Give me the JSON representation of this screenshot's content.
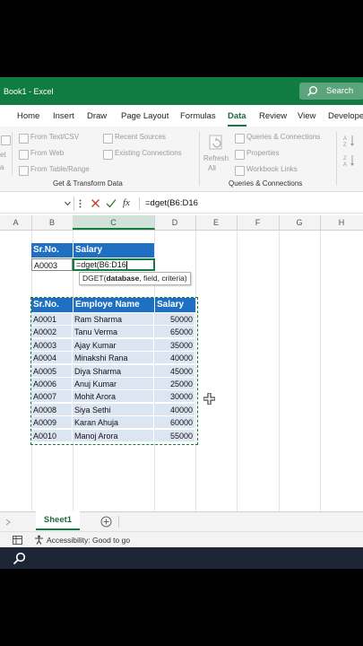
{
  "window": {
    "title": "Book1  -  Excel",
    "search_label": "Search"
  },
  "tabs": [
    "Home",
    "Insert",
    "Draw",
    "Page Layout",
    "Formulas",
    "Data",
    "Review",
    "View",
    "Develope"
  ],
  "active_tab": "Data",
  "ribbon": {
    "left_partial": [
      "et",
      "a"
    ],
    "get_transform": {
      "items": [
        "From Text/CSV",
        "From Web",
        "From Table/Range"
      ],
      "recent": [
        "Recent Sources",
        "Existing Connections"
      ],
      "group_label": "Get & Transform Data"
    },
    "refresh": {
      "line1": "Refresh",
      "line2": "All"
    },
    "queries": {
      "items": [
        "Queries & Connections",
        "Properties",
        "Workbook Links"
      ],
      "group_label": "Queries & Connections"
    },
    "sort_icons": [
      "A Z sort",
      "Z A sort"
    ]
  },
  "formula_bar": {
    "fx": "fx",
    "formula": "=dget(B6:D16"
  },
  "columns": [
    "A",
    "B",
    "C",
    "D",
    "E",
    "F",
    "G",
    "H"
  ],
  "criteria_table": {
    "headers": [
      "Sr.No.",
      "Salary"
    ],
    "row": [
      "A0003",
      "=dget(B6:D16"
    ]
  },
  "tooltip": {
    "fn": "DGET(",
    "arg1": "database",
    "rest": ", field, criteria)"
  },
  "data_table": {
    "headers": [
      "Sr.No.",
      "Employe Name",
      "Salary"
    ],
    "rows": [
      [
        "A0001",
        "Ram Sharma",
        "50000"
      ],
      [
        "A0002",
        "Tanu Verma",
        "65000"
      ],
      [
        "A0003",
        "Ajay Kumar",
        "35000"
      ],
      [
        "A0004",
        "Minakshi Rana",
        "40000"
      ],
      [
        "A0005",
        "Diya Sharma",
        "45000"
      ],
      [
        "A0006",
        "Anuj Kumar",
        "25000"
      ],
      [
        "A0007",
        "Mohit Arora",
        "30000"
      ],
      [
        "A0008",
        "Siya Sethi",
        "40000"
      ],
      [
        "A0009",
        "Karan Ahuja",
        "60000"
      ],
      [
        "A0010",
        "Manoj Arora",
        "55000"
      ]
    ]
  },
  "sheets": {
    "active": "Sheet1"
  },
  "status": {
    "accessibility": "Accessibility: Good to go"
  },
  "colors": {
    "excel_green": "#107c41",
    "header_blue": "#1f6fc2",
    "row_fill": "#dce6f2"
  }
}
